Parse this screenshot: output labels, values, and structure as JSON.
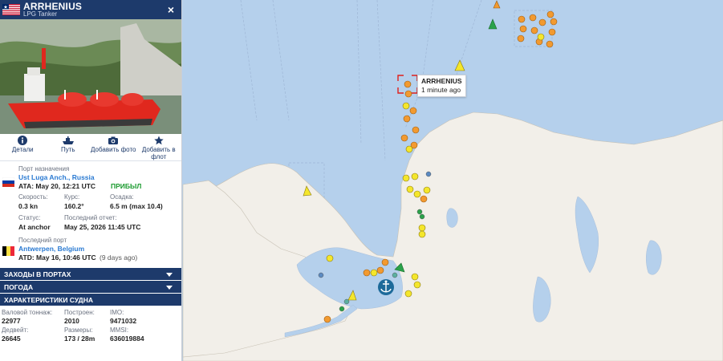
{
  "vessel": {
    "name": "ARRHENIUS",
    "type": "LPG Tanker",
    "close_label": "×"
  },
  "actions": [
    {
      "label": "Детали",
      "icon": "info-icon"
    },
    {
      "label": "Путь",
      "icon": "ship-route-icon"
    },
    {
      "label": "Добавить фото",
      "icon": "camera-icon"
    },
    {
      "label": "Добавить в флот",
      "icon": "star-icon"
    }
  ],
  "destination": {
    "label": "Порт назначения",
    "port": "Ust Luga Anch., Russia",
    "ata": "ATA: May 20, 12:21 UTC",
    "status": "ПРИБЫЛ"
  },
  "nav": {
    "speed_label": "Скорость:",
    "speed": "0.3 kn",
    "course_label": "Курс:",
    "course": "160.2°",
    "draught_label": "Осадка:",
    "draught": "6.5 m (max 10.4)",
    "status_label": "Статус:",
    "status": "At anchor",
    "last_report_label": "Последний отчет:",
    "last_report": "May 25, 2026 11:45 UTC"
  },
  "last_port": {
    "label": "Последний порт",
    "port": "Antwerpen, Belgium",
    "atd": "ATD: May 16, 10:46 UTC",
    "ago": "(9 days ago)"
  },
  "bars": {
    "port_calls": "ЗАХОДЫ В ПОРТАХ",
    "weather": "ПОГОДА",
    "specs": "ХАРАКТЕРИСТИКИ СУДНА"
  },
  "specs": {
    "gt_label": "Валовой тоннаж:",
    "gt": "22977",
    "built_label": "Построен:",
    "built": "2010",
    "imo_label": "IMO:",
    "imo": "9471032",
    "dwt_label": "Дедвейт:",
    "dwt": "26645",
    "size_label": "Размеры:",
    "size": "173 / 28m",
    "mmsi_label": "MMSI:",
    "mmsi": "636019884"
  },
  "map_popup": {
    "name": "ARRHENIUS",
    "time": "1 minute ago"
  },
  "colors": {
    "panel_header": "#1d3a6b",
    "sea": "#b5d0ec",
    "land": "#f2efe9",
    "link": "#2a7ad2",
    "arrived": "#1a9a2e",
    "marker_orange": "#f29a30",
    "marker_yellow": "#f4e62c",
    "marker_green": "#2aa24a"
  }
}
